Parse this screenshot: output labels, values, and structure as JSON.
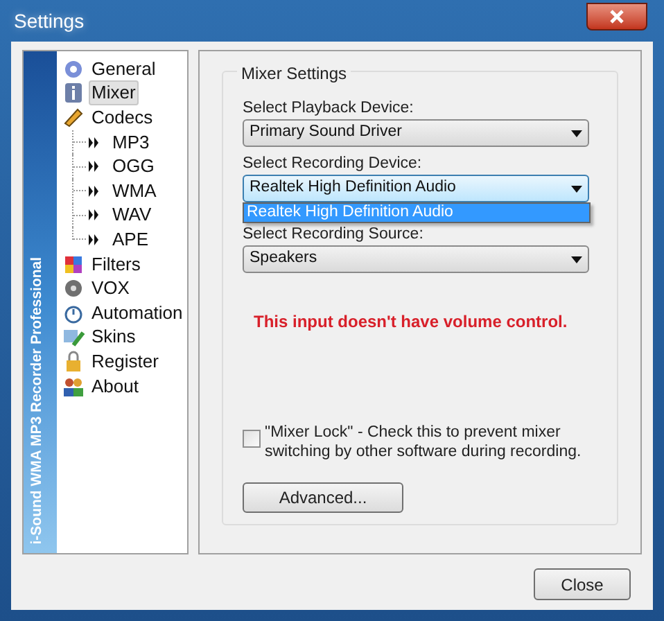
{
  "window": {
    "title": "Settings"
  },
  "sidebar": {
    "banner": "i-Sound WMA MP3 Recorder Professional",
    "items": [
      {
        "label": "General",
        "kind": "gear",
        "selected": false
      },
      {
        "label": "Mixer",
        "kind": "info",
        "selected": true
      },
      {
        "label": "Codecs",
        "kind": "pencil",
        "selected": false,
        "children": [
          {
            "label": "MP3",
            "selected": false
          },
          {
            "label": "OGG",
            "selected": false
          },
          {
            "label": "WMA",
            "selected": false
          },
          {
            "label": "WAV",
            "selected": false
          },
          {
            "label": "APE",
            "selected": false
          }
        ]
      },
      {
        "label": "Filters",
        "kind": "palette",
        "selected": false
      },
      {
        "label": "VOX",
        "kind": "disc",
        "selected": false
      },
      {
        "label": "Automation",
        "kind": "timer",
        "selected": false
      },
      {
        "label": "Skins",
        "kind": "brush",
        "selected": false
      },
      {
        "label": "Register",
        "kind": "lock",
        "selected": false
      },
      {
        "label": "About",
        "kind": "people",
        "selected": false
      }
    ]
  },
  "mixer_settings": {
    "title": "Mixer Settings",
    "fields": [
      {
        "label": "Select Playback Device:",
        "value": "Primary Sound Driver",
        "expanded": false
      },
      {
        "label": "Select Recording Device:",
        "value": "Realtek High Definition Audio",
        "expanded": true,
        "options": [
          {
            "label": "Realtek High Definition Audio",
            "selected": true
          }
        ]
      },
      {
        "label": "Select Recording Source:",
        "value": "Speakers",
        "expanded": false
      }
    ],
    "message": "This input doesn't have volume control.",
    "mixer_lock": {
      "label": "\"Mixer Lock\" - Check this to prevent mixer switching by other software during recording.",
      "checked": false
    },
    "advanced_button": "Advanced..."
  },
  "close_button": "Close"
}
